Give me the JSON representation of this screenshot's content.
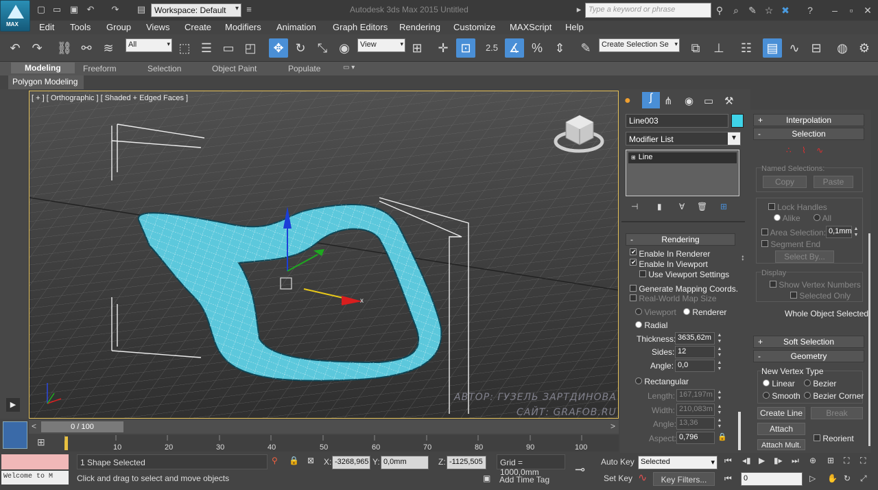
{
  "app": {
    "logo_label": "MAX",
    "workspace": "Workspace: Default",
    "title": "Autodesk 3ds Max 2015     Untitled",
    "search_placeholder": "Type a keyword or phrase"
  },
  "menu": [
    "Edit",
    "Tools",
    "Group",
    "Views",
    "Create",
    "Modifiers",
    "Animation",
    "Graph Editors",
    "Rendering",
    "Customize",
    "MAXScript",
    "Help"
  ],
  "toolbar": {
    "selection_filter": "All",
    "ref_coord": "View",
    "snap_value": "2.5",
    "named_selection": "Create Selection Se"
  },
  "ribbon": {
    "tabs": [
      "Modeling",
      "Freeform",
      "Selection",
      "Object Paint",
      "Populate"
    ],
    "active_tab": "Modeling",
    "panel_label": "Polygon Modeling"
  },
  "viewport": {
    "label": "[ + ] [ Orthographic ] [ Shaded + Edged Faces ]",
    "watermark_line1": "АВТОР: ГУЗЕЛЬ ЗАРТДИНОВА",
    "watermark_line2": "САЙТ: GRAFOB.RU",
    "gizmo_x_label": "x"
  },
  "timeline": {
    "frame": "0 / 100",
    "ticks": [
      "10",
      "20",
      "30",
      "40",
      "50",
      "60",
      "70",
      "80",
      "90",
      "100"
    ]
  },
  "status": {
    "selected": "1 Shape Selected",
    "prompt": "Click and drag to select and move objects",
    "welcome": "Welcome to M",
    "x_label": "X:",
    "x": "-3268,965",
    "y_label": "Y:",
    "y": "0,0mm",
    "z_label": "Z:",
    "z": "-1125,505",
    "grid": "Grid = 1000,0mm",
    "add_time_tag": "Add Time Tag",
    "auto_key": "Auto Key",
    "set_key": "Set Key",
    "key_mode": "Selected",
    "key_filters": "Key Filters...",
    "current_frame": "0"
  },
  "command_panel": {
    "object_name": "Line003",
    "object_color": "#3fd3e8",
    "modifier_list": "Modifier List",
    "stack_item": "Line",
    "rendering": {
      "title": "Rendering",
      "enable_in_renderer": "Enable In Renderer",
      "enable_in_viewport": "Enable In Viewport",
      "use_viewport_settings": "Use Viewport Settings",
      "generate_mapping": "Generate Mapping Coords.",
      "real_world_map": "Real-World Map Size",
      "viewport": "Viewport",
      "renderer": "Renderer",
      "radial": "Radial",
      "thickness_label": "Thickness:",
      "thickness": "3635,62m",
      "sides_label": "Sides:",
      "sides": "12",
      "angle_label": "Angle:",
      "angle": "0,0",
      "rectangular": "Rectangular",
      "length_label": "Length:",
      "length": "167,197m",
      "width_label": "Width:",
      "width": "210,083m",
      "angle2_label": "Angle:",
      "angle2": "13,36",
      "aspect_label": "Aspect:",
      "aspect": "0,796"
    }
  },
  "right_panel": {
    "interpolation": "Interpolation",
    "selection": "Selection",
    "named_selections": "Named Selections:",
    "copy": "Copy",
    "paste": "Paste",
    "lock_handles": "Lock Handles",
    "alike": "Alike",
    "all": "All",
    "area_selection": "Area Selection:",
    "area_value": "0,1mm",
    "segment_end": "Segment End",
    "select_by": "Select By...",
    "display": "Display",
    "show_vertex_numbers": "Show Vertex Numbers",
    "selected_only": "Selected Only",
    "whole_object_selected": "Whole Object Selected",
    "soft_selection": "Soft Selection",
    "geometry": "Geometry",
    "new_vertex_type": "New Vertex Type",
    "linear": "Linear",
    "bezier": "Bezier",
    "smooth": "Smooth",
    "bezier_corner": "Bezier Corner",
    "create_line": "Create Line",
    "break": "Break",
    "attach": "Attach",
    "reorient": "Reorient",
    "attach_mult": "Attach Mult."
  }
}
